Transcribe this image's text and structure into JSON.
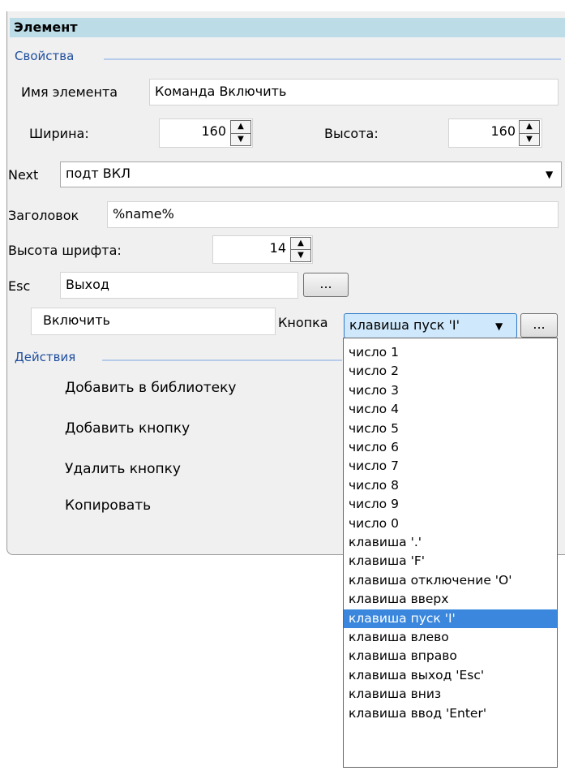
{
  "panel_title": "Элемент",
  "sections": {
    "properties": "Свойства",
    "actions": "Действия"
  },
  "fields": {
    "element_name": {
      "label": "Имя элемента",
      "value": "Команда Включить"
    },
    "width": {
      "label": "Ширина:",
      "value": "160"
    },
    "height": {
      "label": "Высота:",
      "value": "160"
    },
    "next": {
      "label": "Next",
      "value": "подт ВКЛ"
    },
    "caption": {
      "label": "Заголовок",
      "value": "%name%"
    },
    "font_height": {
      "label": "Высота шрифта:",
      "value": "14"
    },
    "esc": {
      "label": "Esc",
      "value": "Выход"
    },
    "button_text": {
      "value": "Включить"
    },
    "button_key": {
      "label": "Кнопка",
      "value": "клавиша пуск 'I'"
    }
  },
  "ellipsis": "...",
  "actions": [
    "Добавить в библиотеку",
    "Добавить кнопку",
    "Удалить кнопку",
    "Копировать"
  ],
  "dropdown": {
    "items": [
      "число 1",
      "число 2",
      "число 3",
      "число 4",
      "число 5",
      "число 6",
      "число 7",
      "число 8",
      "число 9",
      "число 0",
      "клавиша '.'",
      "клавиша 'F'",
      "клавиша отключение 'O'",
      "клавиша вверх",
      "клавиша пуск 'I'",
      "клавиша влево",
      "клавиша вправо",
      "клавиша выход 'Esc'",
      "клавиша вниз",
      "клавиша ввод 'Enter'"
    ],
    "selected_index": 14
  },
  "colors": {
    "title_bar": "#bcdce8",
    "section_text": "#1f4e9e",
    "selection": "#3a87dd"
  }
}
